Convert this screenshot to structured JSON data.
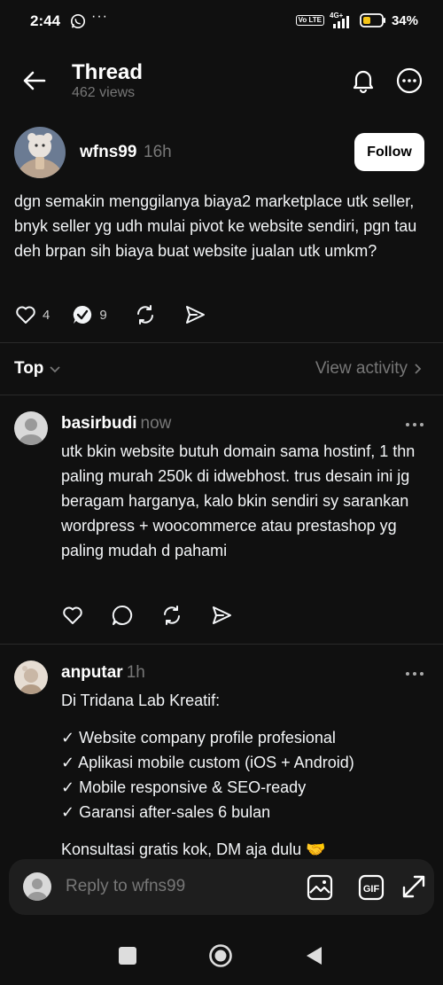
{
  "status_bar": {
    "time": "2:44",
    "dots": "···",
    "volte": "Vo LTE",
    "network": "4G+",
    "battery": "34%"
  },
  "header": {
    "title": "Thread",
    "views": "462 views"
  },
  "post": {
    "username": "wfns99",
    "time": "16h",
    "follow_label": "Follow",
    "text": "dgn semakin menggilanya biaya2 marketplace utk seller, bnyk seller yg udh mulai pivot ke website sendiri, pgn tau deh brpan sih biaya buat website jualan utk umkm?",
    "likes": "4",
    "replies": "9"
  },
  "sort": {
    "label": "Top",
    "view_activity": "View activity"
  },
  "replies": [
    {
      "username": "basirbudi",
      "time": "now",
      "text": "utk bkin website butuh domain sama hostinf, 1 thn paling murah 250k di idwebhost. trus desain ini jg beragam harganya, kalo bkin sendiri sy sarankan wordpress + woocommerce atau prestashop yg paling mudah d pahami"
    },
    {
      "username": "anputar",
      "time": "1h",
      "lines": [
        "Di Tridana Lab Kreatif:",
        "✓ Website company profile profesional",
        "✓ Aplikasi mobile custom (iOS + Android)",
        "✓ Mobile responsive & SEO-ready",
        "✓ Garansi after-sales 6 bulan",
        "Konsultasi gratis kok, DM aja dulu 🤝"
      ]
    }
  ],
  "composer": {
    "placeholder": "Reply to wfns99"
  }
}
